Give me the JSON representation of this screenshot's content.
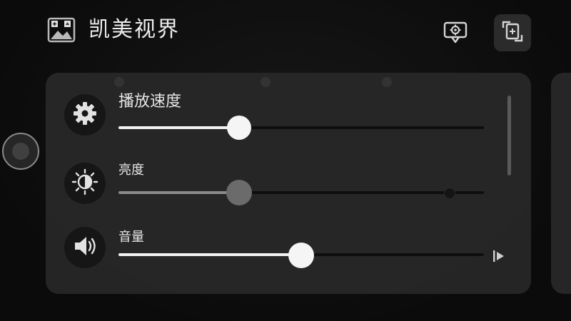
{
  "header": {
    "title": "凯美视界",
    "logo_icon": "image-gallery-icon",
    "screenshot_icon": "camera-screenshot-icon",
    "rotate_icon": "screen-rotate-icon"
  },
  "settings": {
    "playback_speed": {
      "label": "播放速度",
      "icon": "gear-icon",
      "value": 0.33
    },
    "brightness": {
      "label": "亮度",
      "icon": "brightness-icon",
      "value": 0.33
    },
    "volume": {
      "label": "音量",
      "icon": "speaker-icon",
      "value": 0.5
    }
  },
  "colors": {
    "background": "#0d0d0d",
    "panel": "#282828",
    "text": "#e6e6e6",
    "slider_fill_active": "#f2f2f2",
    "slider_fill_dim": "#8a8a8a"
  }
}
